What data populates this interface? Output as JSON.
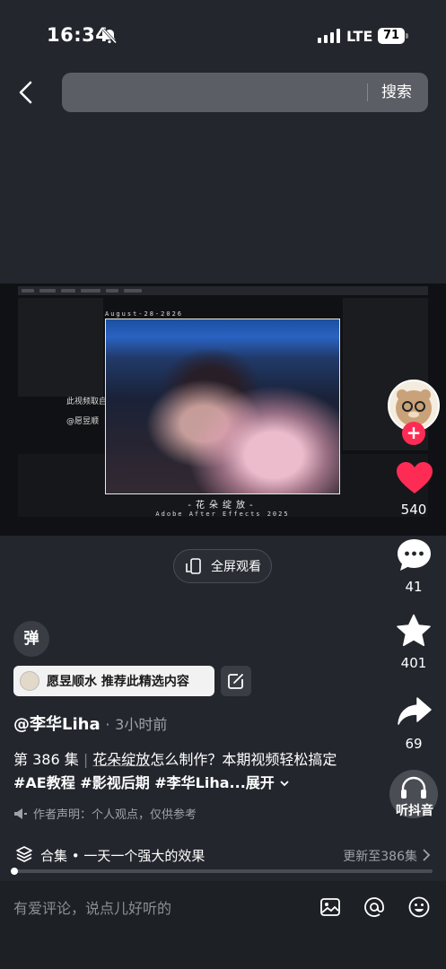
{
  "status_bar": {
    "time": "16:34",
    "network": "LTE",
    "battery": "71"
  },
  "header": {
    "search_placeholder": "",
    "search_button": "搜索"
  },
  "video": {
    "date_text": "August-28-2026",
    "watermark_line1": "此视频取自",
    "watermark_line2": "@愿昱顺",
    "caption_title": "-花朵绽放-",
    "caption_sub": "Adobe After Effects 2025"
  },
  "fullscreen_label": "全屏观看",
  "sidebar": {
    "likes": "540",
    "comments": "41",
    "favorites": "401",
    "shares": "69",
    "listen_label": "听抖音"
  },
  "danmaku_label": "弹",
  "recommend": {
    "text": "愿昱顺水 推荐此精选内容"
  },
  "author": {
    "name": "@李华Liha",
    "dot": "·",
    "time": "3小时前"
  },
  "description": {
    "episode": "第 386 集",
    "link": "花朵绽放",
    "text": "怎么制作？本期视频轻松搞定 ",
    "tags": "#AE教程 #影视后期 #李华Liha...",
    "more": "展开"
  },
  "disclaimer": "作者声明：个人观点，仅供参考",
  "collection": {
    "title": "合集 • 一天一个强大的效果",
    "update": "更新至386集"
  },
  "comment_bar": {
    "placeholder": "有爱评论，说点儿好听的"
  },
  "colors": {
    "like": "#fe2c55",
    "background": "#23262d"
  }
}
